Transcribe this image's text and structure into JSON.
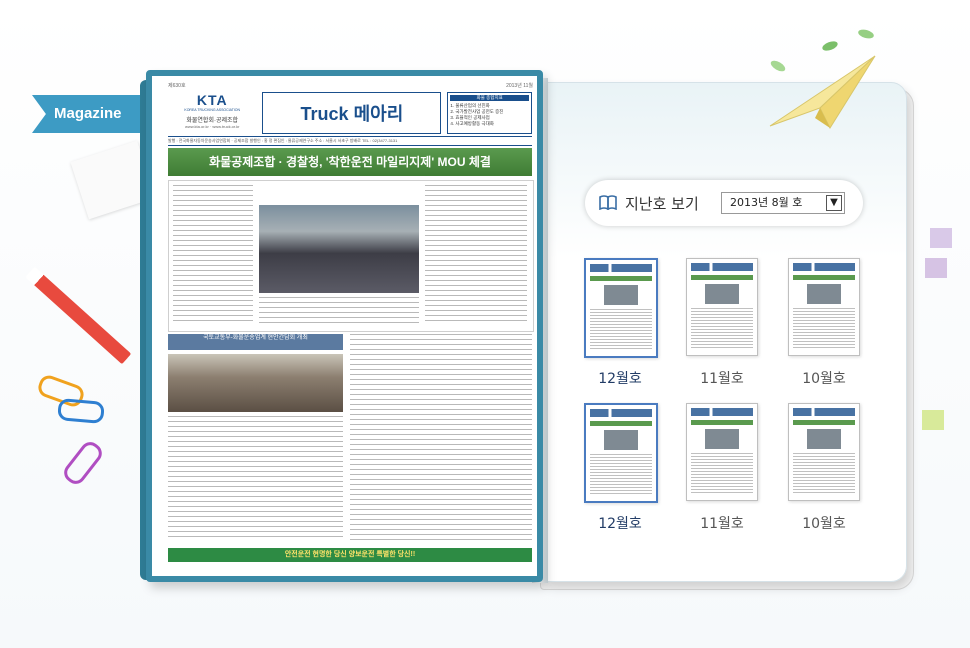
{
  "tab": {
    "label": "Magazine"
  },
  "newspaper": {
    "issue_no": "제630호",
    "issue_date": "2013년 11월",
    "logo": "KTA",
    "logo_sub": "KOREA TRUCKING ASSOCIATION",
    "logo_kor": "화물연합회·공제조합",
    "logo_url": "www.kta.or.kr · www.truck.or.kr",
    "title": "Truck 메아리",
    "index_head": "화물 종합지표",
    "index_items": [
      "1. 물류산업의 선진화",
      "2. 국가발전사업 공헌도 증진",
      "3. 효율적인 공제사업",
      "4. 사고예방활동 극대화"
    ],
    "pub_info": "발행 : 전국화물자동차운송사업연합회 · 공제조합  발행인 : 홍 정  편집인 : 물류공제연구소  주소 : 서울시 서초구 방배로  TEL : 02)3477-3131",
    "headline": "화물공제조합 · 경찰청, '착한운전 마일리지제' MOU 체결",
    "lower_title": "국토교통부-화물운송업계 현안간담회 개최",
    "footer": "안전운전 현명한 당신 양보운전 특별한 당신!!"
  },
  "archive": {
    "label": "지난호 보기",
    "select_value": "2013년  8월 호",
    "icon": "open-book-icon",
    "dropdown_icon": "chevron-down-icon"
  },
  "thumbs": [
    {
      "label": "12월호",
      "active": true
    },
    {
      "label": "11월호",
      "active": false
    },
    {
      "label": "10월호",
      "active": false
    },
    {
      "label": "12월호",
      "active": true
    },
    {
      "label": "11월호",
      "active": false
    },
    {
      "label": "10월호",
      "active": false
    }
  ],
  "colors": {
    "accent": "#3d9bc4",
    "book_border": "#3a8aa6",
    "headline_green": "#3f7c34",
    "masthead_blue": "#1a4f8c"
  }
}
